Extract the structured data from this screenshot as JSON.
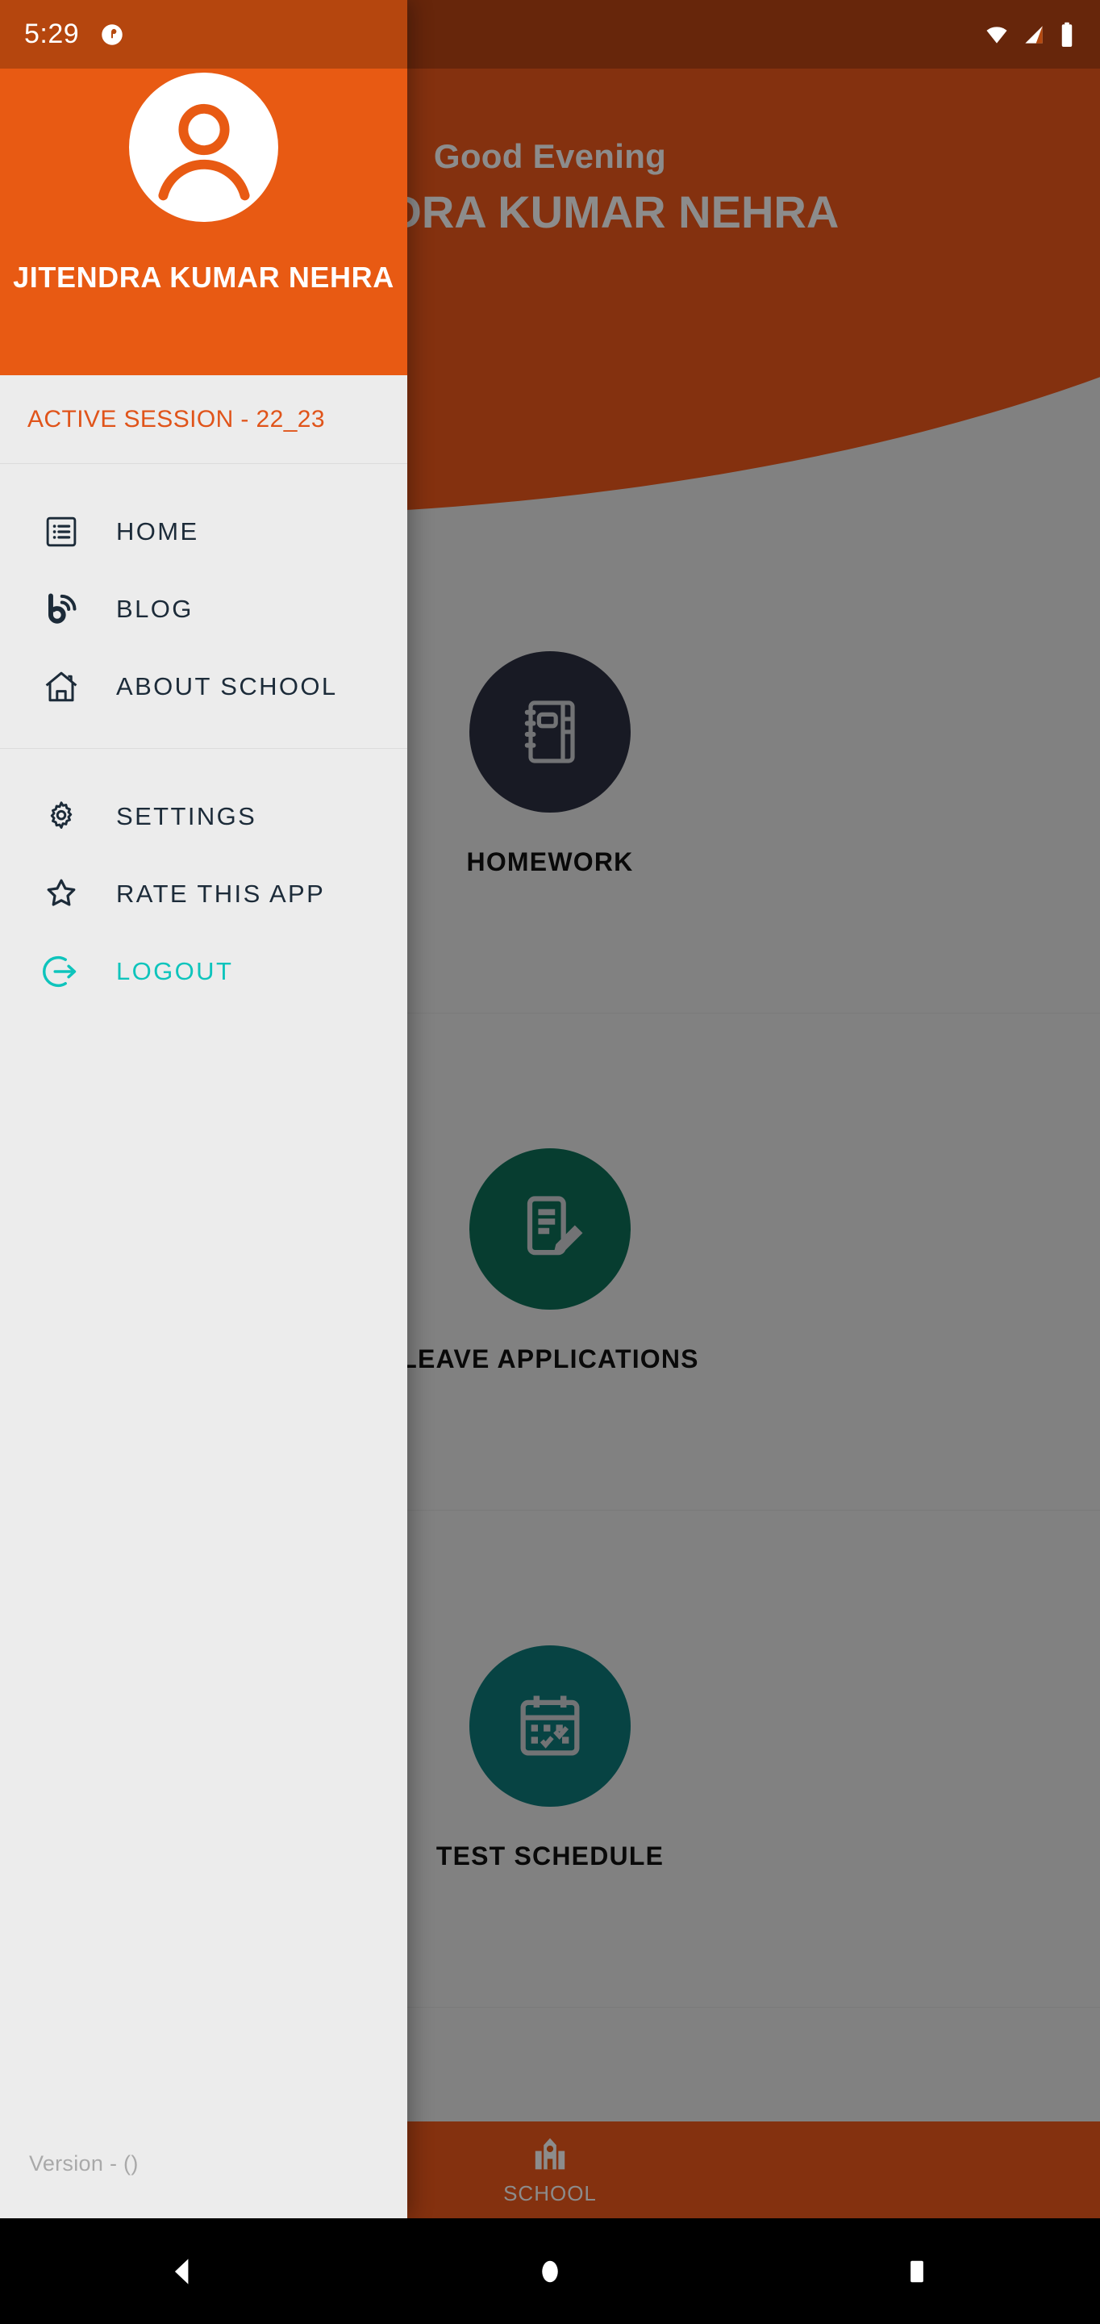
{
  "status_bar": {
    "time": "5:29",
    "notification_icon": "notification-dot-icon",
    "wifi_icon": "wifi-icon",
    "signal_icon": "cellular-signal-icon",
    "battery_icon": "battery-full-icon"
  },
  "drawer": {
    "avatar_icon": "user-avatar-icon",
    "username": "JITENDRA KUMAR NEHRA",
    "session_label": "ACTIVE SESSION - 22_23",
    "groups": [
      {
        "items": [
          {
            "label": "HOME",
            "icon": "list-box-icon"
          },
          {
            "label": "BLOG",
            "icon": "blog-rss-icon"
          },
          {
            "label": "ABOUT SCHOOL",
            "icon": "home-house-icon"
          }
        ]
      },
      {
        "items": [
          {
            "label": "SETTINGS",
            "icon": "gear-icon"
          },
          {
            "label": "RATE THIS APP",
            "icon": "star-icon"
          },
          {
            "label": "LOGOUT",
            "icon": "logout-arrow-icon"
          }
        ]
      }
    ],
    "version": "Version -  ()",
    "colors": {
      "header_bg": "#e85a13",
      "session_text": "#e0541a",
      "item_text": "#1c2b39",
      "logout_text": "#0ec4bc",
      "version_text": "#a9a9a9"
    }
  },
  "background": {
    "greeting": "Good Evening",
    "username": "JITENDRA KUMAR NEHRA",
    "header_color": "#f15a1c",
    "tiles": [
      {
        "label": "HOMEWORK",
        "icon": "notebook-icon",
        "circle_color": "#2d3142"
      },
      {
        "label": "LEAVE APPLICATIONS",
        "icon": "document-pencil-icon",
        "circle_color": "#0d7058"
      },
      {
        "label": "TEST SCHEDULE",
        "icon": "calendar-check-icon",
        "circle_color": "#0d7b7b"
      }
    ],
    "bottom_nav": [
      {
        "label": "SCHOOL",
        "icon": "school-building-icon"
      }
    ]
  },
  "android_nav": {
    "back": "back-triangle-icon",
    "home": "home-circle-icon",
    "recents": "recents-square-icon"
  }
}
